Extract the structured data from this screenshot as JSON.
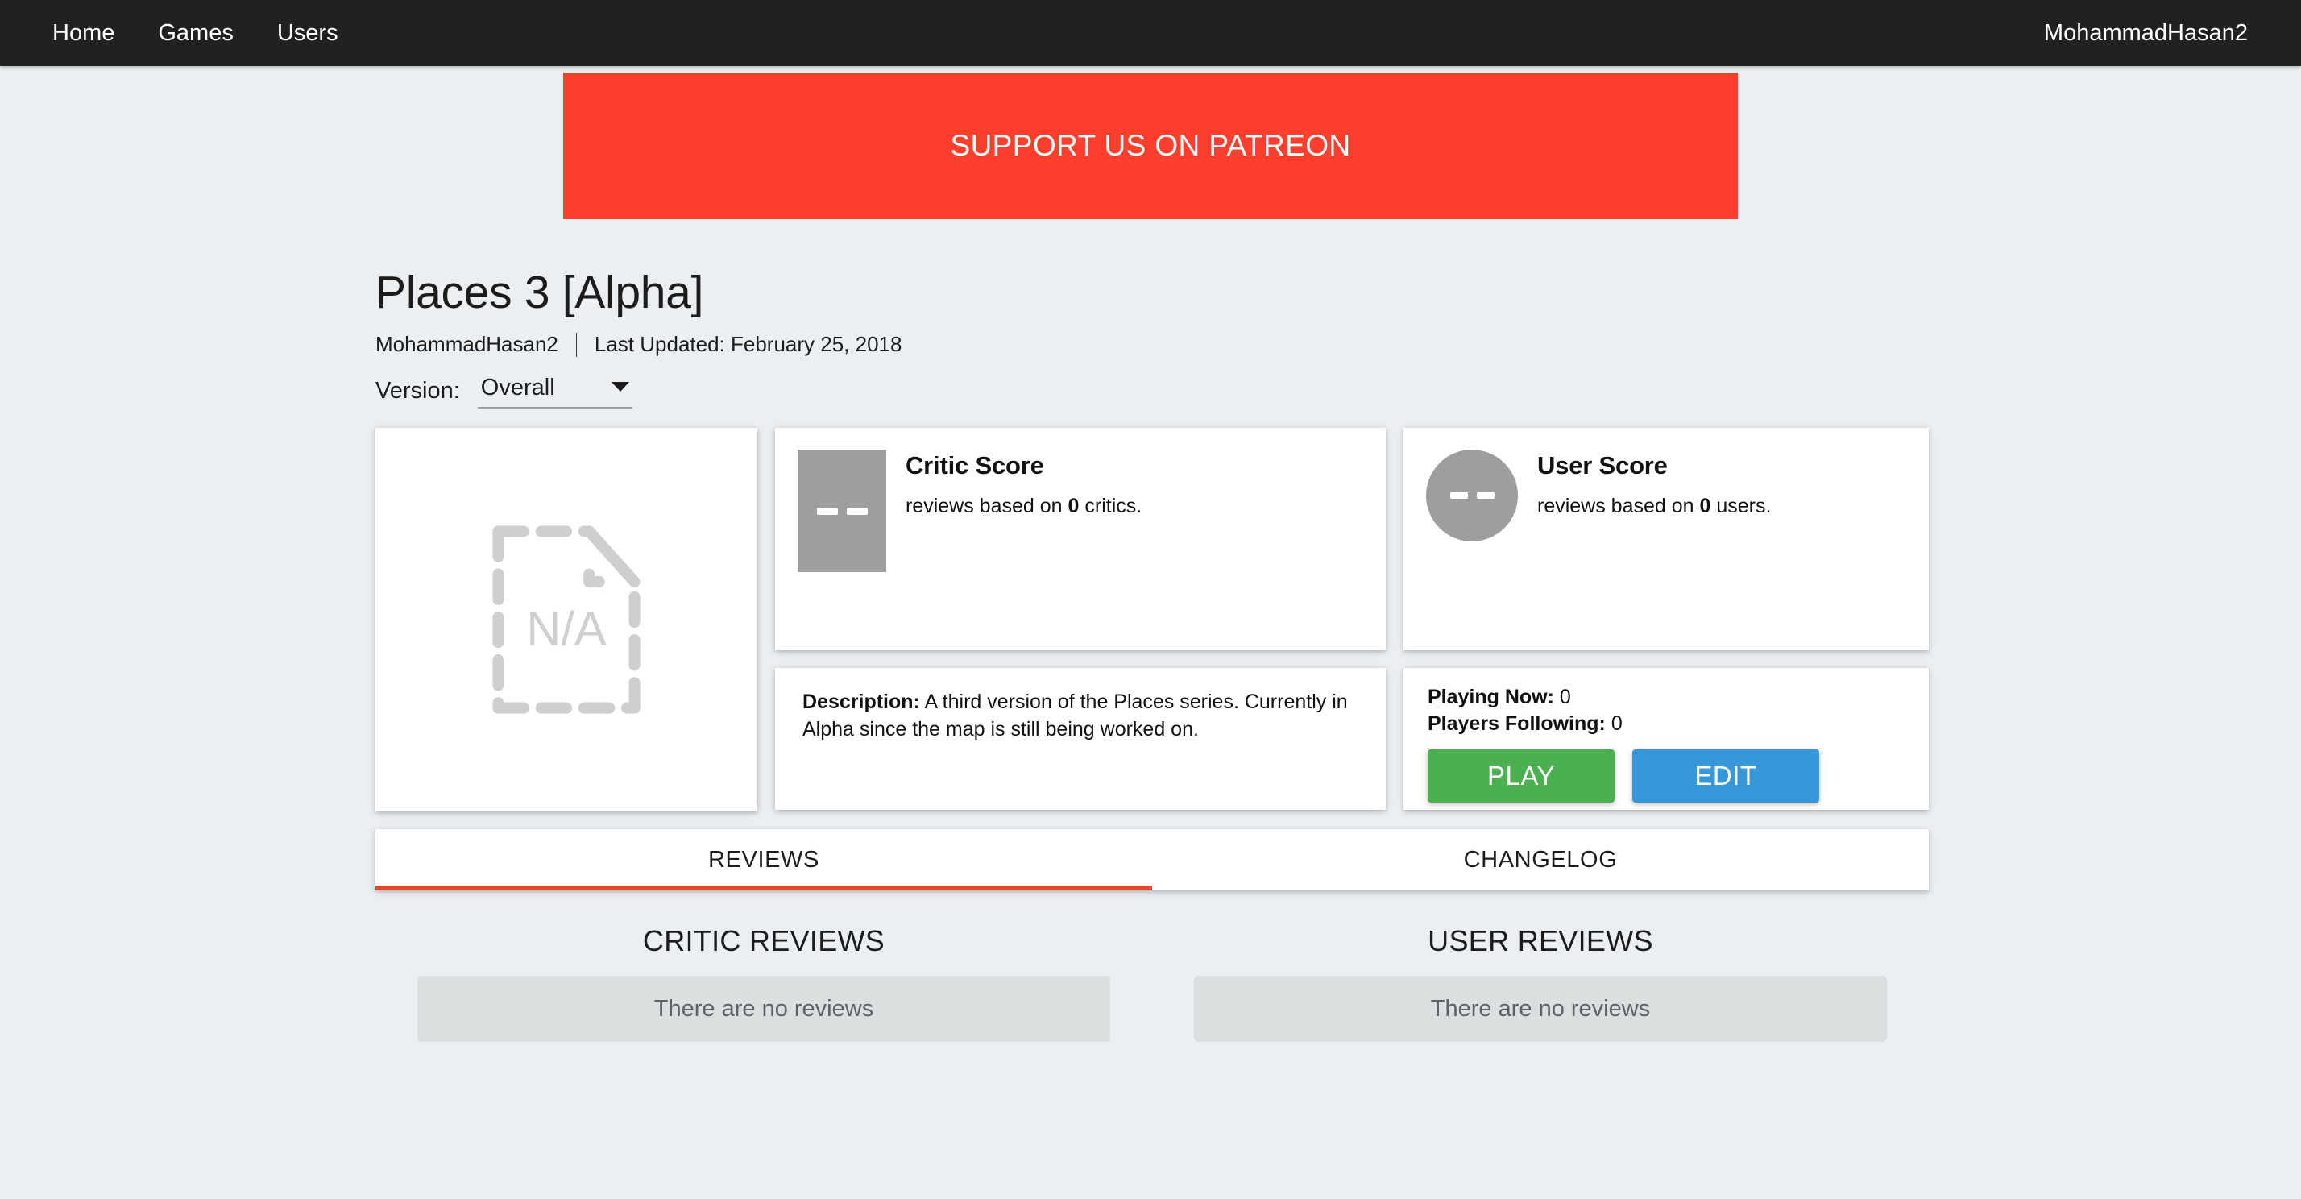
{
  "navbar": {
    "links": [
      {
        "label": "Home"
      },
      {
        "label": "Games"
      },
      {
        "label": "Users"
      }
    ],
    "user": "MohammadHasan2"
  },
  "banner": {
    "label": "SUPPORT US ON PATREON",
    "color": "#fc3f2d"
  },
  "game": {
    "title": "Places 3 [Alpha]",
    "author": "MohammadHasan2",
    "last_updated": "Last Updated: February 25, 2018",
    "version_label": "Version:",
    "version_value": "Overall",
    "image_placeholder": "N/A",
    "description_label": "Description:",
    "description": "A third version of the Places series. Currently in Alpha since the map is still being worked on."
  },
  "critic_score": {
    "title": "Critic Score",
    "value": "--",
    "sub_prefix": "reviews based on",
    "count": "0",
    "sub_suffix": "critics."
  },
  "user_score": {
    "title": "User Score",
    "value": "--",
    "sub_prefix": "reviews based on",
    "count": "0",
    "sub_suffix": "users."
  },
  "stats": {
    "playing_now_label": "Playing Now:",
    "playing_now_value": "0",
    "following_label": "Players Following:",
    "following_value": "0"
  },
  "buttons": {
    "play": "PLAY",
    "play_color": "#4caf50",
    "edit": "EDIT",
    "edit_color": "#3498db"
  },
  "tabs": {
    "reviews": "REVIEWS",
    "changelog": "CHANGELOG",
    "active_color": "#e8452c"
  },
  "reviews": {
    "critic_heading": "CRITIC REVIEWS",
    "critic_empty": "There are no reviews",
    "user_heading": "USER REVIEWS",
    "user_empty": "There are no reviews"
  }
}
